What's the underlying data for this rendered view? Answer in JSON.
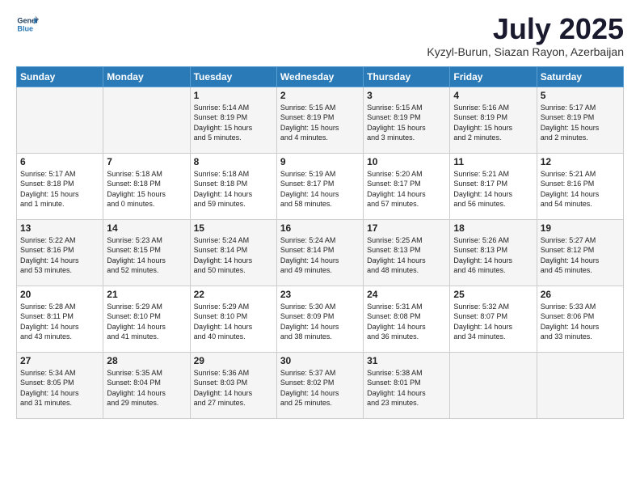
{
  "logo": {
    "line1": "General",
    "line2": "Blue"
  },
  "title": "July 2025",
  "location": "Kyzyl-Burun, Siazan Rayon, Azerbaijan",
  "headers": [
    "Sunday",
    "Monday",
    "Tuesday",
    "Wednesday",
    "Thursday",
    "Friday",
    "Saturday"
  ],
  "weeks": [
    [
      {
        "day": "",
        "info": ""
      },
      {
        "day": "",
        "info": ""
      },
      {
        "day": "1",
        "info": "Sunrise: 5:14 AM\nSunset: 8:19 PM\nDaylight: 15 hours\nand 5 minutes."
      },
      {
        "day": "2",
        "info": "Sunrise: 5:15 AM\nSunset: 8:19 PM\nDaylight: 15 hours\nand 4 minutes."
      },
      {
        "day": "3",
        "info": "Sunrise: 5:15 AM\nSunset: 8:19 PM\nDaylight: 15 hours\nand 3 minutes."
      },
      {
        "day": "4",
        "info": "Sunrise: 5:16 AM\nSunset: 8:19 PM\nDaylight: 15 hours\nand 2 minutes."
      },
      {
        "day": "5",
        "info": "Sunrise: 5:17 AM\nSunset: 8:19 PM\nDaylight: 15 hours\nand 2 minutes."
      }
    ],
    [
      {
        "day": "6",
        "info": "Sunrise: 5:17 AM\nSunset: 8:18 PM\nDaylight: 15 hours\nand 1 minute."
      },
      {
        "day": "7",
        "info": "Sunrise: 5:18 AM\nSunset: 8:18 PM\nDaylight: 15 hours\nand 0 minutes."
      },
      {
        "day": "8",
        "info": "Sunrise: 5:18 AM\nSunset: 8:18 PM\nDaylight: 14 hours\nand 59 minutes."
      },
      {
        "day": "9",
        "info": "Sunrise: 5:19 AM\nSunset: 8:17 PM\nDaylight: 14 hours\nand 58 minutes."
      },
      {
        "day": "10",
        "info": "Sunrise: 5:20 AM\nSunset: 8:17 PM\nDaylight: 14 hours\nand 57 minutes."
      },
      {
        "day": "11",
        "info": "Sunrise: 5:21 AM\nSunset: 8:17 PM\nDaylight: 14 hours\nand 56 minutes."
      },
      {
        "day": "12",
        "info": "Sunrise: 5:21 AM\nSunset: 8:16 PM\nDaylight: 14 hours\nand 54 minutes."
      }
    ],
    [
      {
        "day": "13",
        "info": "Sunrise: 5:22 AM\nSunset: 8:16 PM\nDaylight: 14 hours\nand 53 minutes."
      },
      {
        "day": "14",
        "info": "Sunrise: 5:23 AM\nSunset: 8:15 PM\nDaylight: 14 hours\nand 52 minutes."
      },
      {
        "day": "15",
        "info": "Sunrise: 5:24 AM\nSunset: 8:14 PM\nDaylight: 14 hours\nand 50 minutes."
      },
      {
        "day": "16",
        "info": "Sunrise: 5:24 AM\nSunset: 8:14 PM\nDaylight: 14 hours\nand 49 minutes."
      },
      {
        "day": "17",
        "info": "Sunrise: 5:25 AM\nSunset: 8:13 PM\nDaylight: 14 hours\nand 48 minutes."
      },
      {
        "day": "18",
        "info": "Sunrise: 5:26 AM\nSunset: 8:13 PM\nDaylight: 14 hours\nand 46 minutes."
      },
      {
        "day": "19",
        "info": "Sunrise: 5:27 AM\nSunset: 8:12 PM\nDaylight: 14 hours\nand 45 minutes."
      }
    ],
    [
      {
        "day": "20",
        "info": "Sunrise: 5:28 AM\nSunset: 8:11 PM\nDaylight: 14 hours\nand 43 minutes."
      },
      {
        "day": "21",
        "info": "Sunrise: 5:29 AM\nSunset: 8:10 PM\nDaylight: 14 hours\nand 41 minutes."
      },
      {
        "day": "22",
        "info": "Sunrise: 5:29 AM\nSunset: 8:10 PM\nDaylight: 14 hours\nand 40 minutes."
      },
      {
        "day": "23",
        "info": "Sunrise: 5:30 AM\nSunset: 8:09 PM\nDaylight: 14 hours\nand 38 minutes."
      },
      {
        "day": "24",
        "info": "Sunrise: 5:31 AM\nSunset: 8:08 PM\nDaylight: 14 hours\nand 36 minutes."
      },
      {
        "day": "25",
        "info": "Sunrise: 5:32 AM\nSunset: 8:07 PM\nDaylight: 14 hours\nand 34 minutes."
      },
      {
        "day": "26",
        "info": "Sunrise: 5:33 AM\nSunset: 8:06 PM\nDaylight: 14 hours\nand 33 minutes."
      }
    ],
    [
      {
        "day": "27",
        "info": "Sunrise: 5:34 AM\nSunset: 8:05 PM\nDaylight: 14 hours\nand 31 minutes."
      },
      {
        "day": "28",
        "info": "Sunrise: 5:35 AM\nSunset: 8:04 PM\nDaylight: 14 hours\nand 29 minutes."
      },
      {
        "day": "29",
        "info": "Sunrise: 5:36 AM\nSunset: 8:03 PM\nDaylight: 14 hours\nand 27 minutes."
      },
      {
        "day": "30",
        "info": "Sunrise: 5:37 AM\nSunset: 8:02 PM\nDaylight: 14 hours\nand 25 minutes."
      },
      {
        "day": "31",
        "info": "Sunrise: 5:38 AM\nSunset: 8:01 PM\nDaylight: 14 hours\nand 23 minutes."
      },
      {
        "day": "",
        "info": ""
      },
      {
        "day": "",
        "info": ""
      }
    ]
  ]
}
